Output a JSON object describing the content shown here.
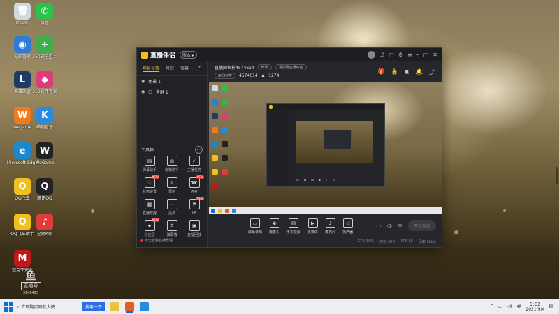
{
  "desktop": {
    "icons": [
      {
        "label": "回收站",
        "glyph": "🗑",
        "color": "#d0d8e0"
      },
      {
        "label": "微信",
        "glyph": "✆",
        "color": "#2bc24a"
      },
      {
        "label": "电脑管家",
        "glyph": "◉",
        "color": "#2f7bd8"
      },
      {
        "label": "360安全卫士",
        "glyph": "+",
        "color": "#3db04a"
      },
      {
        "label": "英雄联盟",
        "glyph": "L",
        "color": "#1f3a66"
      },
      {
        "label": "360软件管家",
        "glyph": "◆",
        "color": "#e03a7a"
      },
      {
        "label": "Wegame",
        "glyph": "W",
        "color": "#f07a20"
      },
      {
        "label": "酷狗音乐",
        "glyph": "K",
        "color": "#2a8ae0"
      },
      {
        "label": "Microsoft Edge",
        "glyph": "e",
        "color": "#1a8ad0"
      },
      {
        "label": "WeGame",
        "glyph": "W",
        "color": "#222"
      },
      {
        "label": "QQ飞车",
        "glyph": "Q",
        "color": "#f0c020"
      },
      {
        "label": "腾讯QQ",
        "glyph": "Q",
        "color": "#222"
      },
      {
        "label": "QQ飞车助手",
        "glyph": "Q",
        "color": "#f0c020"
      },
      {
        "label": "全民K歌",
        "glyph": "♪",
        "color": "#e03a3a"
      },
      {
        "label": "迈克菲安全",
        "glyph": "M",
        "color": "#c01818"
      }
    ]
  },
  "window": {
    "app_name": "直播伴侣",
    "version_badge": "版本 ▸",
    "scene_tabs": [
      "场景设置",
      "音效",
      "弹幕"
    ],
    "scene_items": [
      {
        "label": "场景 1"
      },
      {
        "label": "全屏 1"
      }
    ],
    "tools_title": "工具箱",
    "tools": [
      {
        "label": "弹幕助手",
        "icon": "▤",
        "tag": ""
      },
      {
        "label": "房管助手",
        "icon": "◍",
        "tag": ""
      },
      {
        "label": "主播任务",
        "icon": "✓",
        "tag": ""
      },
      {
        "label": "礼物设置",
        "icon": "♡",
        "tag": "NEW"
      },
      {
        "label": "录制",
        "icon": "⇩",
        "tag": ""
      },
      {
        "label": "连麦",
        "icon": "☎",
        "tag": "NEW"
      },
      {
        "label": "直播数据",
        "icon": "▦",
        "tag": ""
      },
      {
        "label": "更多",
        "icon": "⋯",
        "tag": ""
      },
      {
        "label": "PK",
        "icon": "⚑",
        "tag": "NEW"
      },
      {
        "label": "粉丝团",
        "icon": "★",
        "tag": "NEW"
      },
      {
        "label": "弹幕墙",
        "icon": "↧",
        "tag": ""
      },
      {
        "label": "直播回放",
        "icon": "▣",
        "tag": ""
      }
    ],
    "tip": "点击查看直播教程",
    "info": {
      "title": "直播间名称4574614",
      "edit_label": "修改",
      "tag_label": "请设置直播标签",
      "room_label": "房间标签",
      "room_id": "4574614",
      "followers": "1274"
    },
    "controls": [
      {
        "label": "屏幕录制",
        "icon": "▭"
      },
      {
        "label": "摄像头",
        "icon": "◉"
      },
      {
        "label": "手机投屏",
        "icon": "▤"
      },
      {
        "label": "多媒体",
        "icon": "▶"
      },
      {
        "label": "麦克风",
        "icon": "♪"
      },
      {
        "label": "扬声器",
        "icon": "◁"
      }
    ],
    "go_live": "开始直播",
    "status_items": [
      "CPU 18%",
      "内存 38%",
      "FPS 30",
      "码率 0kb/s"
    ]
  },
  "watermark": {
    "big": "鱼",
    "box": "直播号",
    "small": "3148425"
  },
  "taskbar": {
    "search_text": "立即购买同款大使",
    "search_button": "搜索一下",
    "time": "9:02",
    "date": "2021/9/4",
    "ime": "英"
  }
}
